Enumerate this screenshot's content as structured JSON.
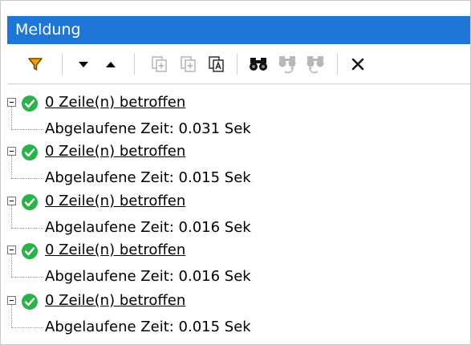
{
  "panel": {
    "title": "Meldung"
  },
  "toolbar": {
    "buttons": [
      {
        "name": "filter-icon"
      },
      {
        "name": "next-icon"
      },
      {
        "name": "previous-icon"
      },
      {
        "name": "copy-selected-icon"
      },
      {
        "name": "copy-all-icon"
      },
      {
        "name": "copy-all-text-icon"
      },
      {
        "name": "find-icon"
      },
      {
        "name": "find-previous-icon"
      },
      {
        "name": "find-next-icon"
      },
      {
        "name": "close-icon"
      }
    ]
  },
  "messages": [
    {
      "summary": "0 Zeile(n) betroffen",
      "elapsed": "Abgelaufene Zeit: 0.031 Sek"
    },
    {
      "summary": "0 Zeile(n) betroffen",
      "elapsed": "Abgelaufene Zeit: 0.015 Sek"
    },
    {
      "summary": "0 Zeile(n) betroffen",
      "elapsed": "Abgelaufene Zeit: 0.016 Sek"
    },
    {
      "summary": "0 Zeile(n) betroffen",
      "elapsed": "Abgelaufene Zeit: 0.016 Sek"
    },
    {
      "summary": "0 Zeile(n) betroffen",
      "elapsed": "Abgelaufene Zeit: 0.015 Sek"
    }
  ],
  "colors": {
    "titlebar": "#1e76d6",
    "success": "#2bb24a",
    "filter": "#f5a100"
  }
}
